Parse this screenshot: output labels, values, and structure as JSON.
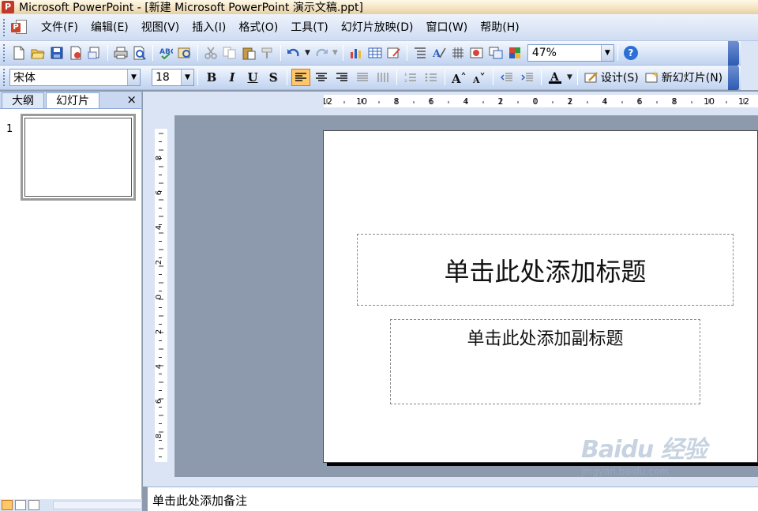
{
  "window": {
    "title": "Microsoft PowerPoint - [新建 Microsoft PowerPoint 演示文稿.ppt]"
  },
  "menu": {
    "items": [
      "文件(F)",
      "编辑(E)",
      "视图(V)",
      "插入(I)",
      "格式(O)",
      "工具(T)",
      "幻灯片放映(D)",
      "窗口(W)",
      "帮助(H)"
    ]
  },
  "standard_toolbar": {
    "zoom": "47%"
  },
  "formatting_toolbar": {
    "font_name": "宋体",
    "font_size": "18",
    "bold": "B",
    "italic": "I",
    "underline": "U",
    "shadow": "S",
    "design_label": "设计(S)",
    "new_slide_label": "新幻灯片(N)"
  },
  "left_pane": {
    "tab_outline": "大纲",
    "tab_slides": "幻灯片",
    "close": "×",
    "slide_number": "1"
  },
  "slide": {
    "title_placeholder": "单击此处添加标题",
    "subtitle_placeholder": "单击此处添加副标题"
  },
  "notes": {
    "placeholder": "单击此处添加备注"
  },
  "watermark": {
    "main": "Baidu 经验",
    "sub": "jingyan.baidu.com"
  },
  "colors": {
    "active_button": "#ffc66b",
    "toolbar": "#c1d3f0",
    "workspace": "#8d9aae"
  }
}
